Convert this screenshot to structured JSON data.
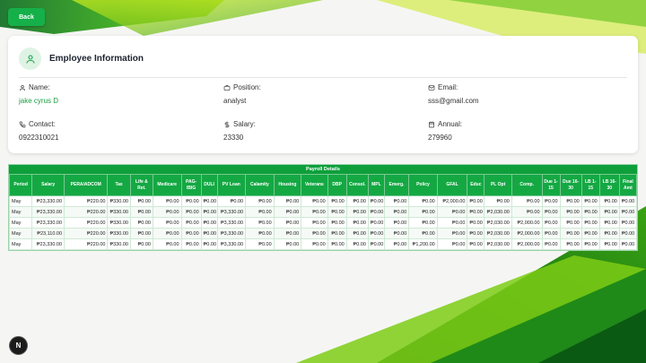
{
  "back_label": "Back",
  "employee": {
    "title": "Employee Information",
    "fields": {
      "name": {
        "label": "Name:",
        "value": "jake cyrus D"
      },
      "position": {
        "label": "Position:",
        "value": "analyst"
      },
      "email": {
        "label": "Email:",
        "value": "sss@gmail.com"
      },
      "contact": {
        "label": "Contact:",
        "value": "0922310021"
      },
      "salary": {
        "label": "Salary:",
        "value": "23330"
      },
      "annual": {
        "label": "Annual:",
        "value": "279960"
      }
    }
  },
  "payroll": {
    "title": "Payroll Details",
    "columns": [
      "Period",
      "Salary",
      "PERA/ADCOM",
      "Tax",
      "Life & Ret.",
      "Medicare",
      "PAG-IBIG",
      "DULI",
      "PV Loan",
      "Calamity",
      "Housing",
      "Veterans",
      "DBP",
      "Consol.",
      "MPL",
      "Emerg.",
      "Policy",
      "GFAL",
      "Educ",
      "PL Opt",
      "Comp.",
      "Due 1-15",
      "Due 16-30",
      "LB 1-15",
      "LB 16-30",
      "Final Amt"
    ],
    "rows": [
      [
        "May",
        "₱23,330.00",
        "₱220.00",
        "₱330.00",
        "₱0.00",
        "₱0.00",
        "₱0.00",
        "₱0.00",
        "₱0.00",
        "₱0.00",
        "₱0.00",
        "₱0.00",
        "₱0.00",
        "₱0.00",
        "₱0.00",
        "₱0.00",
        "₱0.00",
        "₱2,000.00",
        "₱0.00",
        "₱0.00",
        "₱0.00",
        "₱0.00",
        "₱0.00",
        "₱0.00",
        "₱0.00",
        "₱0.00"
      ],
      [
        "May",
        "₱23,330.00",
        "₱220.00",
        "₱330.00",
        "₱0.00",
        "₱0.00",
        "₱0.00",
        "₱0.00",
        "₱3,330.00",
        "₱0.00",
        "₱0.00",
        "₱0.00",
        "₱0.00",
        "₱0.00",
        "₱0.00",
        "₱0.00",
        "₱0.00",
        "₱0.00",
        "₱0.00",
        "₱2,030.00",
        "₱0.00",
        "₱0.00",
        "₱0.00",
        "₱0.00",
        "₱0.00",
        "₱0.00"
      ],
      [
        "May",
        "₱23,330.00",
        "₱220.00",
        "₱330.00",
        "₱0.00",
        "₱0.00",
        "₱0.00",
        "₱0.00",
        "₱3,330.00",
        "₱0.00",
        "₱0.00",
        "₱0.00",
        "₱0.00",
        "₱0.00",
        "₱0.00",
        "₱0.00",
        "₱0.00",
        "₱0.00",
        "₱0.00",
        "₱2,030.00",
        "₱2,000.00",
        "₱0.00",
        "₱0.00",
        "₱0.00",
        "₱0.00",
        "₱0.00"
      ],
      [
        "May",
        "₱23,110.00",
        "₱220.00",
        "₱330.00",
        "₱0.00",
        "₱0.00",
        "₱0.00",
        "₱0.00",
        "₱3,330.00",
        "₱0.00",
        "₱0.00",
        "₱0.00",
        "₱0.00",
        "₱0.00",
        "₱0.00",
        "₱0.00",
        "₱0.00",
        "₱0.00",
        "₱0.00",
        "₱2,030.00",
        "₱2,000.00",
        "₱0.00",
        "₱0.00",
        "₱0.00",
        "₱0.00",
        "₱0.00"
      ],
      [
        "May",
        "₱23,330.00",
        "₱220.00",
        "₱330.00",
        "₱0.00",
        "₱0.00",
        "₱0.00",
        "₱0.00",
        "₱3,330.00",
        "₱0.00",
        "₱0.00",
        "₱0.00",
        "₱0.00",
        "₱0.00",
        "₱0.00",
        "₱0.00",
        "₱1,200.00",
        "₱0.00",
        "₱0.00",
        "₱2,030.00",
        "₱2,000.00",
        "₱0.00",
        "₱0.00",
        "₱0.00",
        "₱0.00",
        "₱0.00"
      ]
    ]
  },
  "dev_badge_label": "N",
  "colors": {
    "accent": "#16b04a",
    "header": "#0e9f3b",
    "value_green": "#1a9d3f"
  }
}
